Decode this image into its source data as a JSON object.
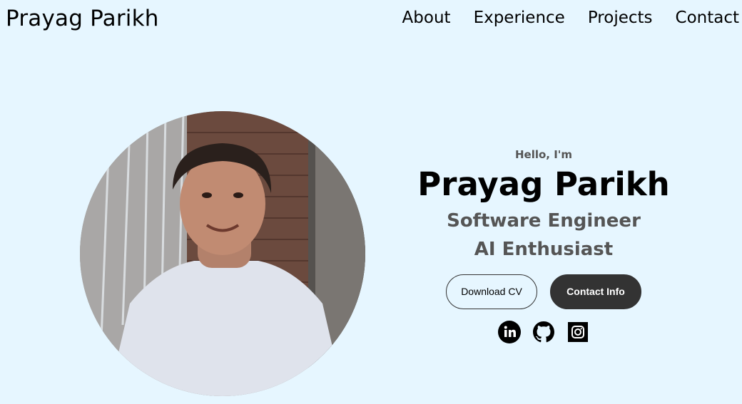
{
  "header": {
    "brand": "Prayag Parikh",
    "nav": [
      {
        "label": "About"
      },
      {
        "label": "Experience"
      },
      {
        "label": "Projects"
      },
      {
        "label": "Contact"
      }
    ]
  },
  "profile": {
    "photo_icon": "profile-photo"
  },
  "hero": {
    "greeting": "Hello, I'm",
    "name": "Prayag Parikh",
    "roles": [
      "Software Engineer",
      "AI Enthusiast"
    ],
    "buttons": {
      "download_cv": "Download CV",
      "contact_info": "Contact Info"
    },
    "socials": [
      {
        "icon": "linkedin-icon"
      },
      {
        "icon": "github-icon"
      },
      {
        "icon": "instagram-icon"
      }
    ]
  },
  "colors": {
    "background": "#e6f6ff",
    "muted_text": "#555555",
    "button_dark": "#333333"
  }
}
